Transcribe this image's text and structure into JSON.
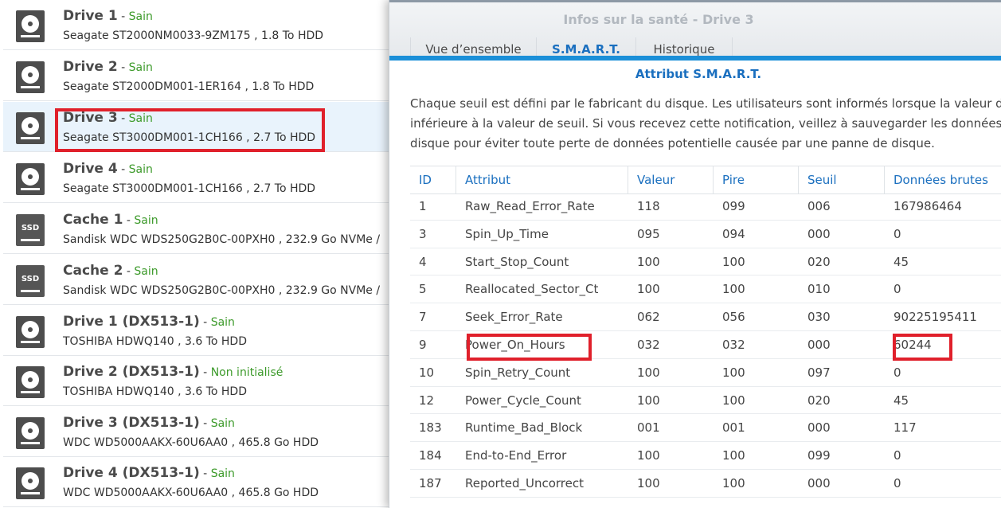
{
  "drives": [
    {
      "name": "Drive 1",
      "sep": " - ",
      "status": "Sain",
      "desc": "Seagate ST2000NM0033-9ZM175 , 1.8 To HDD",
      "icon": "hdd-icon"
    },
    {
      "name": "Drive 2",
      "sep": " - ",
      "status": "Sain",
      "desc": "Seagate ST2000DM001-1ER164 , 1.8 To HDD",
      "icon": "hdd-icon"
    },
    {
      "name": "Drive 3",
      "sep": " - ",
      "status": "Sain",
      "desc": "Seagate ST3000DM001-1CH166 , 2.7 To HDD",
      "icon": "hdd-icon"
    },
    {
      "name": "Drive 4",
      "sep": " - ",
      "status": "Sain",
      "desc": "Seagate ST3000DM001-1CH166 , 2.7 To HDD",
      "icon": "hdd-icon"
    },
    {
      "name": "Cache 1",
      "sep": " - ",
      "status": "Sain",
      "desc": "Sandisk WDC WDS250G2B0C-00PXH0 , 232.9 Go NVMe /",
      "icon": "ssd-icon",
      "icon_label": "SSD"
    },
    {
      "name": "Cache 2",
      "sep": " - ",
      "status": "Sain",
      "desc": "Sandisk WDC WDS250G2B0C-00PXH0 , 232.9 Go NVMe /",
      "icon": "ssd-icon",
      "icon_label": "SSD"
    },
    {
      "name": "Drive 1 (DX513-1)",
      "sep": " - ",
      "status": "Sain",
      "desc": "TOSHIBA HDWQ140 , 3.6 To HDD",
      "icon": "hdd-icon"
    },
    {
      "name": "Drive 2 (DX513-1)",
      "sep": " - ",
      "status": "Non initialisé",
      "desc": "TOSHIBA HDWQ140 , 3.6 To HDD",
      "icon": "hdd-icon"
    },
    {
      "name": "Drive 3 (DX513-1)",
      "sep": " - ",
      "status": "Sain",
      "desc": "WDC WD5000AAKX-60U6AA0 , 465.8 Go HDD",
      "icon": "hdd-icon"
    },
    {
      "name": "Drive 4 (DX513-1)",
      "sep": " - ",
      "status": "Sain",
      "desc": "WDC WD5000AAKX-60U6AA0 , 465.8 Go HDD",
      "icon": "hdd-icon"
    }
  ],
  "selected_drive_index": 2,
  "panel": {
    "title": "Infos sur la santé - Drive 3",
    "tabs": [
      {
        "label": "Vue d’ensemble",
        "active": false
      },
      {
        "label": "S.M.A.R.T.",
        "active": true
      },
      {
        "label": "Historique",
        "active": false
      }
    ],
    "section_title": "Attribut S.M.A.R.T.",
    "description_lines": [
      "Chaque seuil est défini par le fabricant du disque. Les utilisateurs sont informés lorsque la valeur de l'",
      "inférieure à la valeur de seuil. Si vous recevez cette notification, veillez à sauvegarder les données su",
      "disque pour éviter toute perte de données potentielle causée par une panne de disque."
    ]
  },
  "smart_table": {
    "columns": [
      "ID",
      "Attribut",
      "Valeur",
      "Pire",
      "Seuil",
      "Données brutes"
    ],
    "rows": [
      [
        "1",
        "Raw_Read_Error_Rate",
        "118",
        "099",
        "006",
        "167986464"
      ],
      [
        "3",
        "Spin_Up_Time",
        "095",
        "094",
        "000",
        "0"
      ],
      [
        "4",
        "Start_Stop_Count",
        "100",
        "100",
        "020",
        "45"
      ],
      [
        "5",
        "Reallocated_Sector_Ct",
        "100",
        "100",
        "010",
        "0"
      ],
      [
        "7",
        "Seek_Error_Rate",
        "062",
        "056",
        "030",
        "90225195411"
      ],
      [
        "9",
        "Power_On_Hours",
        "032",
        "032",
        "000",
        "60244"
      ],
      [
        "10",
        "Spin_Retry_Count",
        "100",
        "100",
        "097",
        "0"
      ],
      [
        "12",
        "Power_Cycle_Count",
        "100",
        "100",
        "020",
        "45"
      ],
      [
        "183",
        "Runtime_Bad_Block",
        "001",
        "001",
        "000",
        "117"
      ],
      [
        "184",
        "End-to-End_Error",
        "100",
        "100",
        "099",
        "0"
      ],
      [
        "187",
        "Reported_Uncorrect",
        "100",
        "100",
        "000",
        "0"
      ]
    ],
    "highlighted_row_index": 5
  },
  "colors": {
    "status_ok": "#3c9a2a",
    "accent": "#1a6fbf",
    "highlight": "#e0202b"
  }
}
